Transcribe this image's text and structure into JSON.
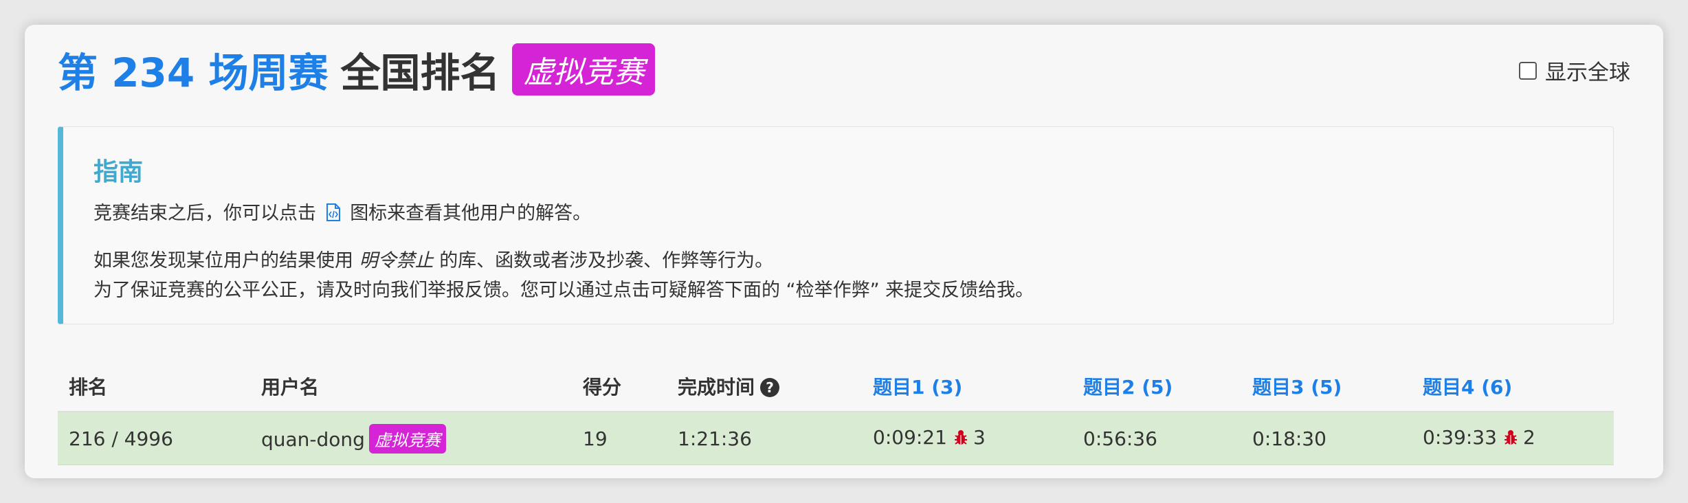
{
  "header": {
    "title_main": "第 234 场周赛",
    "title_sub": "全国排名",
    "badge": "虚拟竞赛",
    "global_toggle_label": "显示全球"
  },
  "guide": {
    "title": "指南",
    "line1_before": "竞赛结束之后，你可以点击",
    "line1_after": "图标来查看其他用户的解答。",
    "line2_before": "如果您发现某位用户的结果使用",
    "line2_em": "明令禁止",
    "line2_after": "的库、函数或者涉及抄袭、作弊等行为。",
    "line3": "为了保证竞赛的公平公正，请及时向我们举报反馈。您可以通过点击可疑解答下面的 “检举作弊” 来提交反馈给我。"
  },
  "table": {
    "headers": {
      "rank": "排名",
      "username": "用户名",
      "score": "得分",
      "finish_time": "完成时间",
      "q1": "题目1 (3)",
      "q2": "题目2 (5)",
      "q3": "题目3 (5)",
      "q4": "题目4 (6)"
    },
    "current_row": {
      "rank": "216 / 4996",
      "username": "quan-dong",
      "badge": "虚拟竞赛",
      "score": "19",
      "finish_time": "1:21:36",
      "q1_time": "0:09:21",
      "q1_bugs": "3",
      "q2_time": "0:56:36",
      "q3_time": "0:18:30",
      "q4_time": "0:39:33",
      "q4_bugs": "2"
    }
  },
  "colors": {
    "title_blue": "#1e7fe6",
    "badge_magenta": "#d524d6",
    "guide_accent": "#56b8d8",
    "row_highlight": "#d9ebd2",
    "bug_red": "#d0021b"
  },
  "icons": [
    "code-file-icon",
    "help-icon",
    "bug-icon",
    "checkbox-icon"
  ]
}
